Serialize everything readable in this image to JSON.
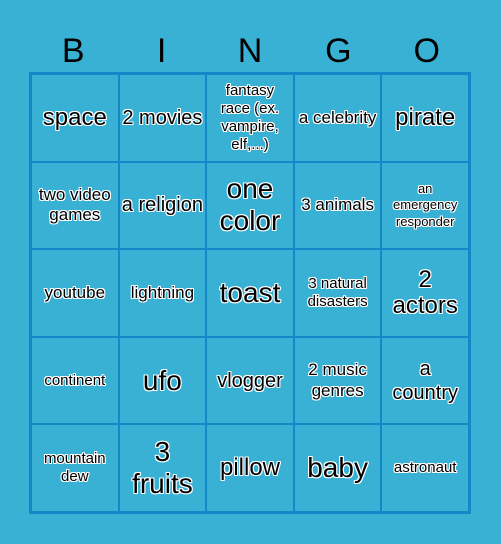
{
  "header": [
    "B",
    "I",
    "N",
    "G",
    "O"
  ],
  "colors": {
    "background": "#38b1d5",
    "grid_line": "#1487c9"
  },
  "cells": [
    "space",
    "2 movies",
    "fantasy race (ex. vampire, elf,...)",
    "a celebrity",
    "pirate",
    "two video games",
    "a religion",
    "one color",
    "3 animals",
    "an emergency responder",
    "youtube",
    "lightning",
    "toast",
    "3 natural disasters",
    "2 actors",
    "continent",
    "ufo",
    "vlogger",
    "2 music genres",
    "a country",
    "mountain dew",
    "3 fruits",
    "pillow",
    "baby",
    "astronaut"
  ]
}
